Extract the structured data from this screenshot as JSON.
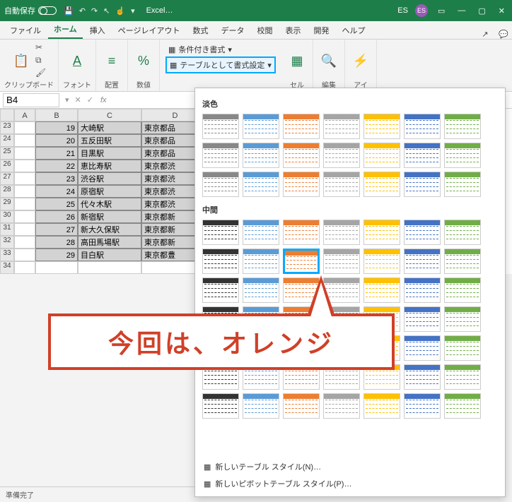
{
  "title": {
    "autosave": "自動保存",
    "appname": "Excel…",
    "user_initials": "ES"
  },
  "tabs": {
    "file": "ファイル",
    "home": "ホーム",
    "insert": "挿入",
    "layout": "ページレイアウト",
    "formula": "数式",
    "data": "データ",
    "review": "校閲",
    "view": "表示",
    "dev": "開発",
    "help": "ヘルプ"
  },
  "ribbon": {
    "paste": "貼り付け",
    "clipboard": "クリップボード",
    "font": "フォント",
    "align": "配置",
    "number": "数値",
    "cond": "条件付き書式",
    "tablefmt": "テーブルとして書式設定",
    "cell": "セル",
    "edit": "編集",
    "idea": "アイ"
  },
  "namebox": "B4",
  "cols": [
    "",
    "A",
    "B",
    "C",
    "D"
  ],
  "rows": [
    {
      "n": 23,
      "b": 19,
      "c": "大崎駅",
      "d": "東京都品"
    },
    {
      "n": 24,
      "b": 20,
      "c": "五反田駅",
      "d": "東京都品"
    },
    {
      "n": 25,
      "b": 21,
      "c": "目黒駅",
      "d": "東京都品"
    },
    {
      "n": 26,
      "b": 22,
      "c": "恵比寿駅",
      "d": "東京都渋"
    },
    {
      "n": 27,
      "b": 23,
      "c": "渋谷駅",
      "d": "東京都渋"
    },
    {
      "n": 28,
      "b": 24,
      "c": "原宿駅",
      "d": "東京都渋"
    },
    {
      "n": 29,
      "b": 25,
      "c": "代々木駅",
      "d": "東京都渋"
    },
    {
      "n": 30,
      "b": 26,
      "c": "新宿駅",
      "d": "東京都新"
    },
    {
      "n": 31,
      "b": 27,
      "c": "新大久保駅",
      "d": "東京都新"
    },
    {
      "n": 32,
      "b": 28,
      "c": "高田馬場駅",
      "d": "東京都新"
    },
    {
      "n": 33,
      "b": 29,
      "c": "目白駅",
      "d": "東京都豊"
    },
    {
      "n": 34,
      "b": "",
      "c": "",
      "d": ""
    }
  ],
  "status": "準備完了",
  "gallery": {
    "light": "淡色",
    "medium": "中間",
    "new_table": "新しいテーブル スタイル(N)…",
    "new_pivot": "新しいピボットテーブル スタイル(P)…"
  },
  "callout": "今回は、オレンジ",
  "palette_light": [
    "#888",
    "#5b9bd5",
    "#ed7d31",
    "#a5a5a5",
    "#ffc000",
    "#4472c4",
    "#70ad47"
  ],
  "palette_med": [
    "#333",
    "#5b9bd5",
    "#ed7d31",
    "#a5a5a5",
    "#ffc000",
    "#4472c4",
    "#70ad47"
  ]
}
